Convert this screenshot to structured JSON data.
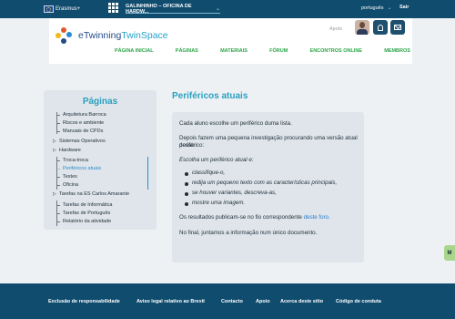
{
  "topbar": {
    "eu_label": "Erasmus+",
    "project": "GALINHINHO – OFICINA DE HARDW...",
    "language": "português",
    "logout": "Sair"
  },
  "header": {
    "logo_part1": "eTwinning",
    "logo_part2": "TwinSpace",
    "support": "Apoio",
    "nav": [
      "PÁGINA INICIAL",
      "PÁGINAS",
      "MATERIAIS",
      "FÓRUM",
      "ENCONTROS ONLINE",
      "MEMBROS"
    ]
  },
  "sidebar": {
    "title": "Páginas",
    "items": [
      "Arquitetura Barroca",
      "Riscos e ambiente",
      "Manuais de CPDs",
      "Sistemas Operativos",
      "Hardware",
      "Troca-troca",
      "Periféricos atuais",
      "Testes",
      "Oficina",
      "Tarefas na ES Carlos Amarante",
      "Tarefas de Informática",
      "Tarefas de Português",
      "Relatório da atividade"
    ]
  },
  "content": {
    "title": "Periféricos atuais",
    "p1": "Cada aluno escolhe um periférico duma lista.",
    "p2a": "Depois fazem uma pequena investigação procurando uma versão atual desse",
    "p2b": "periférico:",
    "p3": "Escolha um periférico atual e:",
    "bullets": [
      "classifique-o,",
      "redija um pequeno texto com as características principais,",
      "se houver variantes, descreva-as,",
      "mostre uma imagem."
    ],
    "p4": "Os resultados publicam-se no fio correspondente",
    "p4_link": "deste foro.",
    "p5": "No final, juntamos a informação num único documento."
  },
  "side_tab": "M",
  "footer": {
    "links": [
      "Exclusão de responsabilidade",
      "Aviso legal relativo ao Brexit",
      "Contacto",
      "Apoio",
      "Acerca deste sítio",
      "Código de conduta"
    ]
  },
  "colors": {
    "topbar": "#0f4c6e",
    "accent_teal": "#2aa0c0",
    "nav_green": "#2fa64a",
    "link_blue": "#2a7fd0"
  }
}
